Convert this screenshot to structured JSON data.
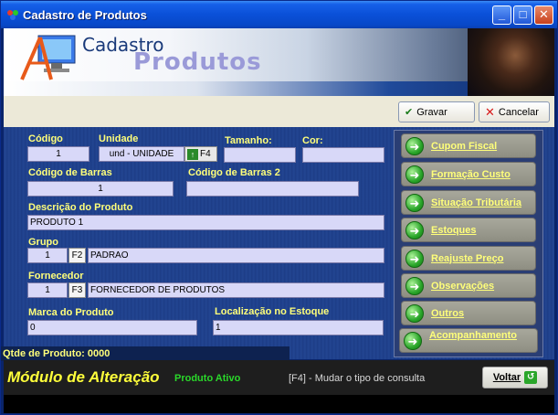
{
  "window": {
    "title": "Cadastro de Produtos"
  },
  "banner": {
    "title_line1": "Cadastro",
    "title_line2": "Produtos"
  },
  "toolbar": {
    "save_label": "Gravar",
    "cancel_label": "Cancelar"
  },
  "form": {
    "codigo": {
      "label": "Código",
      "value": "1"
    },
    "unidade": {
      "label": "Unidade",
      "value": "und - UNIDADE",
      "key": "F4"
    },
    "tamanho": {
      "label": "Tamanho:",
      "value": ""
    },
    "cor": {
      "label": "Cor:",
      "value": ""
    },
    "codigo_barras": {
      "label": "Código de Barras",
      "value": "1"
    },
    "codigo_barras2": {
      "label": "Código de Barras 2",
      "value": ""
    },
    "descricao": {
      "label": "Descrição do Produto",
      "value": "PRODUTO 1"
    },
    "grupo": {
      "label": "Grupo",
      "code": "1",
      "key": "F2",
      "name": "PADRAO"
    },
    "fornecedor": {
      "label": "Fornecedor",
      "code": "1",
      "key": "F3",
      "name": "FORNECEDOR DE PRODUTOS"
    },
    "marca": {
      "label": "Marca do Produto",
      "value": "0"
    },
    "localizacao": {
      "label": "Localização no Estoque",
      "value": "1"
    },
    "qtde": "Qtde de Produto: 0000"
  },
  "side_buttons": [
    {
      "label": "Cupom Fiscal"
    },
    {
      "label": "Formação Custo"
    },
    {
      "label": "Situação Tributária"
    },
    {
      "label": "Estoques"
    },
    {
      "label": "Reajuste Preço"
    },
    {
      "label": "Observações"
    },
    {
      "label": "Outros"
    },
    {
      "label": "Acompanhamento"
    }
  ],
  "bottom": {
    "module_title": "Módulo de Alteração",
    "status": "Produto Ativo",
    "hint": "[F4] - Mudar o tipo de consulta",
    "back_label": "Voltar"
  },
  "colors": {
    "label_yellow": "#ffff7a",
    "panel_blue": "#1e3f8a",
    "status_green": "#2ad82a"
  }
}
